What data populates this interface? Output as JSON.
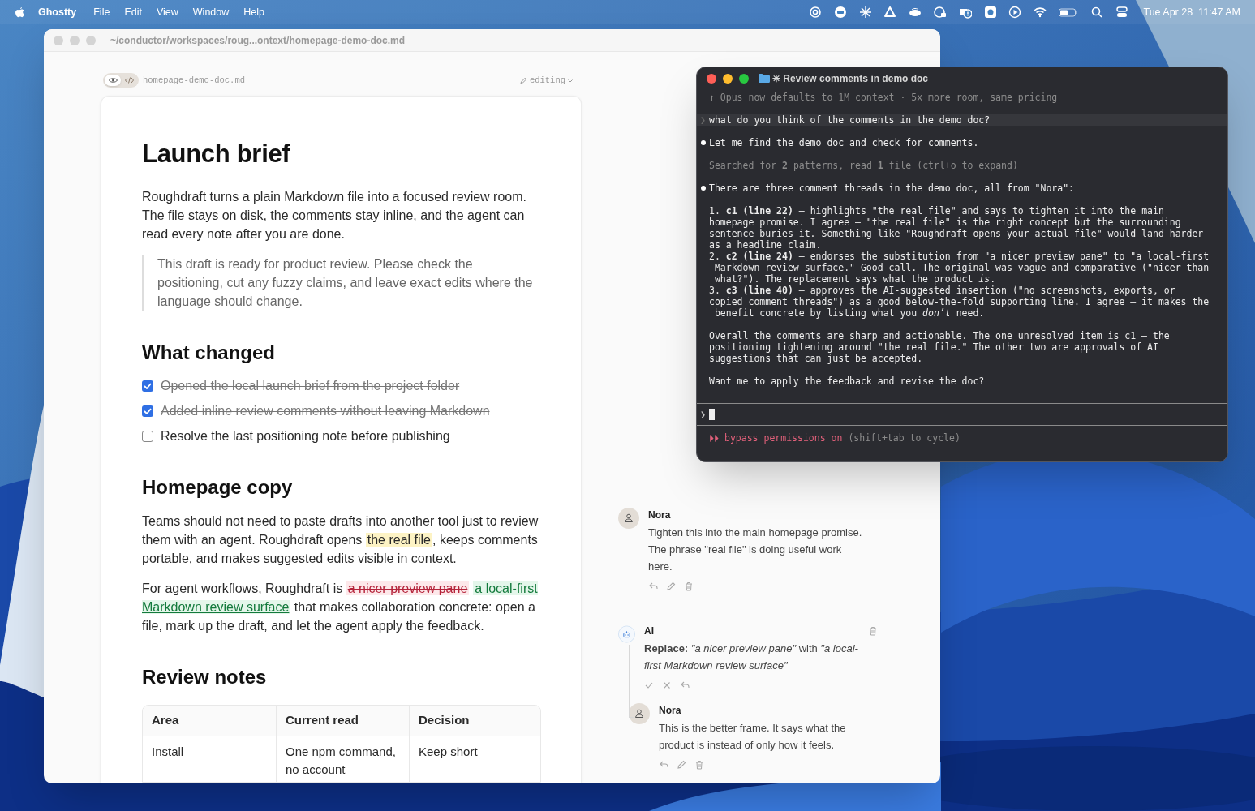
{
  "menu_bar": {
    "app": "Ghostty",
    "menus": [
      "File",
      "Edit",
      "View",
      "Window",
      "Help"
    ],
    "clock": "Tue Apr 28  11:47 AM"
  },
  "editor_window": {
    "title": "~/conductor/workspaces/roug...ontext/homepage-demo-doc.md",
    "toolbar": {
      "view_modes": [
        {
          "kind": "preview",
          "selected": true
        },
        {
          "kind": "source",
          "selected": false
        }
      ],
      "filename": "homepage-demo-doc.md",
      "mode": "editing"
    },
    "document": [
      {
        "kind": "h1",
        "text": "Launch brief"
      },
      {
        "kind": "p",
        "segments": [
          {
            "kind": "plain",
            "text": "Roughdraft turns a plain Markdown file into a focused review room. The file stays on disk, the comments stay inline, and the agent can read every note after you are done."
          }
        ]
      },
      {
        "kind": "quote",
        "text": "This draft is ready for product review. Please check the positioning, cut any fuzzy claims, and leave exact edits where the language should change."
      },
      {
        "kind": "h2",
        "text": "What changed"
      },
      {
        "kind": "tasks",
        "items": [
          {
            "text": "Opened the local launch brief from the project folder",
            "checked": true
          },
          {
            "text": "Added inline review comments without leaving Markdown",
            "checked": true
          },
          {
            "text": "Resolve the last positioning note before publishing",
            "checked": false
          }
        ]
      },
      {
        "kind": "h2",
        "text": "Homepage copy"
      },
      {
        "kind": "p",
        "segments": [
          {
            "kind": "plain",
            "text": "Teams should not need to paste drafts into another tool just to review them with an agent. Roughdraft opens "
          },
          {
            "kind": "highlight",
            "text": "the real file"
          },
          {
            "kind": "plain",
            "text": ", keeps comments portable, and makes suggested edits visible in context."
          }
        ]
      },
      {
        "kind": "p",
        "segments": [
          {
            "kind": "plain",
            "text": "For agent workflows, Roughdraft is "
          },
          {
            "kind": "deleted",
            "text": "a nicer preview pane"
          },
          {
            "kind": "inserted",
            "text": "a local-first Markdown review surface"
          },
          {
            "kind": "plain",
            "text": " that makes collaboration concrete: open a file, mark up the draft, and let the agent apply the feedback."
          }
        ]
      },
      {
        "kind": "h2",
        "text": "Review notes"
      },
      {
        "kind": "table",
        "columns": [
          "Area",
          "Current read",
          "Decision"
        ],
        "rows": [
          [
            "Install",
            "One npm command, no account",
            "Keep short"
          ]
        ]
      }
    ],
    "comments": [
      {
        "kind": "person",
        "author": "Nora",
        "text": "Tighten this into the main homepage promise. The phrase \"real file\" is doing useful work here."
      },
      {
        "kind": "ai",
        "author": "AI",
        "text": "**Replace:** *\"a nicer preview pane\"* with *\"a local-first Markdown review surface\"*",
        "replies": [
          {
            "kind": "person",
            "author": "Nora",
            "text": "This is the better frame. It says what the product is instead of only how it feels."
          }
        ]
      }
    ]
  },
  "terminal": {
    "title": "✳ Review comments in demo doc",
    "lines": [
      {
        "kind": "notice",
        "lines": [
          "↑ Opus now defaults to 1M context · 5x more room, same pricing"
        ]
      },
      {
        "kind": "prompt",
        "marker": "❯",
        "lines": [
          "what do you think of the comments in the demo doc?"
        ]
      },
      {
        "kind": "bullet",
        "lines": [
          "Let me find the demo doc and check for comments."
        ]
      },
      {
        "kind": "dim",
        "lines": [
          "Searched for **2** patterns, read **1** file (ctrl+o to expand)"
        ]
      },
      {
        "kind": "bullet",
        "lines": [
          "There are three comment threads in the demo doc, all from \"Nora\":"
        ]
      },
      {
        "kind": "plain",
        "lines": [
          "1. **c1 (line 22)** — highlights \"the real file\" and says to tighten it into the main",
          "homepage promise. I agree — \"the real file\" is the right concept but the surrounding",
          "sentence buries it. Something like \"Roughdraft opens your actual file\" would land harder",
          "as a headline claim.",
          "2. **c2 (line 24)** — endorses the substitution from \"a nicer preview pane\" to \"a local-first",
          " Markdown review surface.\" Good call. The original was vague and comparative (\"nicer than",
          " what?\"). The replacement says what the product *is*.",
          "3. **c3 (line 40)** — approves the AI-suggested insertion (\"no screenshots, exports, or",
          "copied comment threads\") as a good below-the-fold supporting line. I agree — it makes the",
          " benefit concrete by listing what you *don’t* need."
        ]
      },
      {
        "kind": "plain",
        "lines": [
          "Overall the comments are sharp and actionable. The one unresolved item is c1 — the",
          "positioning tightening around \"the real file.\" The other two are approvals of AI",
          "suggestions that can just be accepted."
        ]
      },
      {
        "kind": "plain",
        "lines": [
          "Want me to apply the feedback and revise the doc?"
        ]
      }
    ],
    "input_marker": "❯",
    "mode_line": {
      "marker": "⏵⏵",
      "text": "bypass permissions on",
      "hint": "(shift+tab to cycle)"
    }
  }
}
